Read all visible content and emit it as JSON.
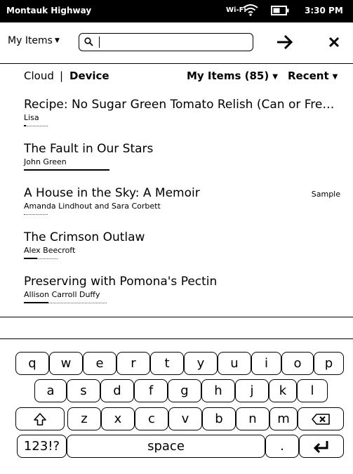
{
  "status_bar": {
    "network": "Montauk Highway",
    "wifi_label": "Wi-Fi",
    "time": "3:30 PM"
  },
  "toolbar": {
    "scope_label": "My Items",
    "search": {
      "value": "",
      "placeholder": ""
    }
  },
  "filter": {
    "cloud": "Cloud",
    "separator": "|",
    "device": "Device",
    "my_items": "My Items (85)",
    "sort": "Recent"
  },
  "books": [
    {
      "title": "Recipe: No Sugar Green Tomato Relish (Can or Fre…",
      "author": "Lisa",
      "progress": 0.1,
      "badge": ""
    },
    {
      "title": "The Fault in Our Stars",
      "author": "John Green",
      "progress": 1.0,
      "badge": ""
    },
    {
      "title": "A House in the Sky: A Memoir",
      "author": "Amanda Lindhout and Sara Corbett",
      "progress": 0.0,
      "badge": "Sample"
    },
    {
      "title": "The Crimson Outlaw",
      "author": "Alex Beecroft",
      "progress": 0.4,
      "badge": ""
    },
    {
      "title": "Preserving with Pomona's Pectin",
      "author": "Allison Carroll Duffy",
      "progress": 0.3,
      "badge": ""
    }
  ],
  "keyboard": {
    "row1": [
      "q",
      "w",
      "e",
      "r",
      "t",
      "y",
      "u",
      "i",
      "o",
      "p"
    ],
    "row2": [
      "a",
      "s",
      "d",
      "f",
      "g",
      "h",
      "j",
      "k",
      "l"
    ],
    "row3": [
      "z",
      "x",
      "c",
      "v",
      "b",
      "n",
      "m"
    ],
    "numbers_key": "123!?",
    "space_key": "space",
    "period_key": "."
  }
}
